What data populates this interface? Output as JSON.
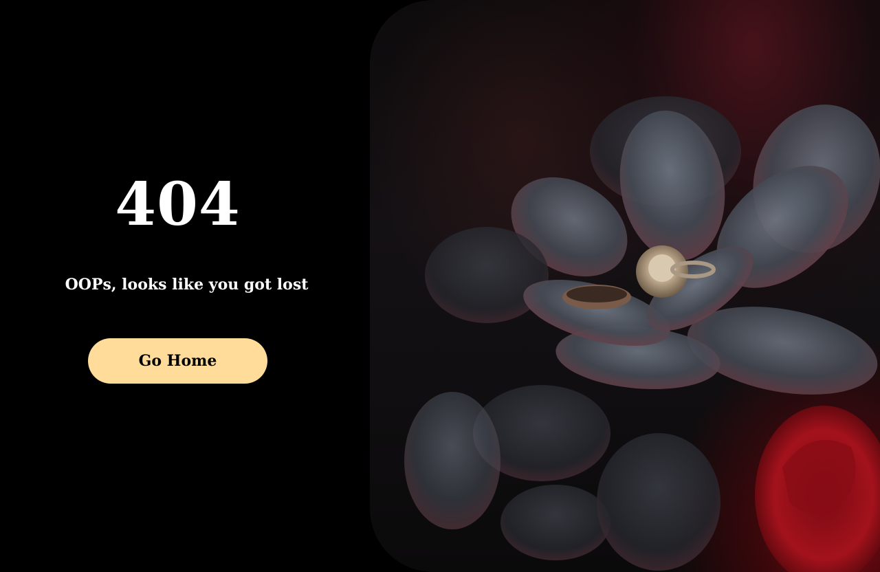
{
  "error": {
    "code": "404",
    "message": "OOPs, looks like you got lost"
  },
  "actions": {
    "home_label": "Go Home"
  },
  "colors": {
    "background": "#000000",
    "text": "#ffffff",
    "button_bg": "#ffdc99",
    "button_text": "#000000"
  },
  "image": {
    "subject": "rings-on-succulent-photo"
  }
}
